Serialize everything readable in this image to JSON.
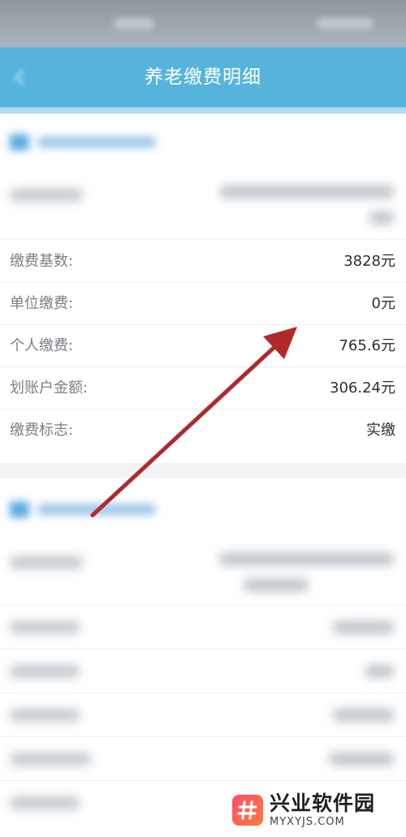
{
  "header": {
    "title": "养老缴费明细"
  },
  "details": [
    {
      "label": "缴费基数:",
      "value": "3828元"
    },
    {
      "label": "单位缴费:",
      "value": "0元"
    },
    {
      "label": "个人缴费:",
      "value": "765.6元"
    },
    {
      "label": "划账户金额:",
      "value": "306.24元"
    },
    {
      "label": "缴费标志:",
      "value": "实缴"
    }
  ],
  "watermark": {
    "name": "兴业软件园",
    "domain": "MYXYJS.COM"
  },
  "colors": {
    "header": "#56b4dc",
    "arrow": "#b02a2a",
    "label": "#7b7f84",
    "value": "#2d2f31"
  }
}
